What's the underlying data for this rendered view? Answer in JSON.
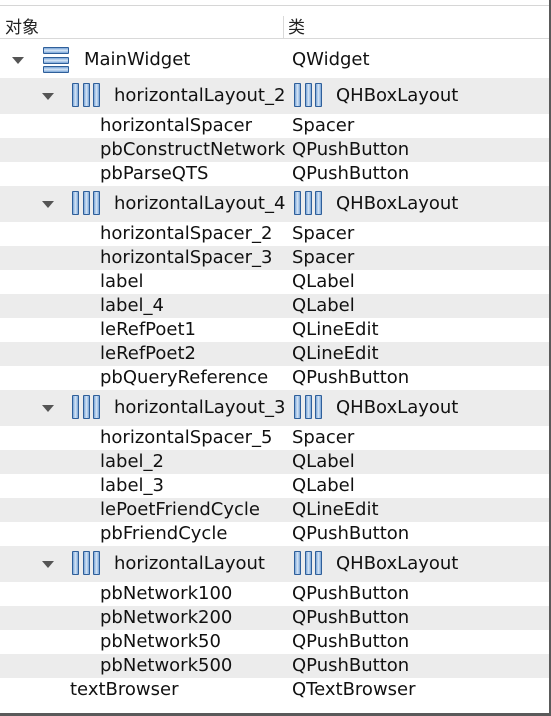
{
  "header": {
    "col_object": "对象",
    "col_class": "类"
  },
  "rows": [
    {
      "level": 0,
      "name": "MainWidget",
      "cls": "QWidget",
      "icon": "form-icon",
      "expand": true,
      "alt": false
    },
    {
      "level": 1,
      "name": "horizontalLayout_2",
      "cls": "QHBoxLayout",
      "icon": "layout-icon",
      "expand": true,
      "alt": true
    },
    {
      "level": 2,
      "name": "horizontalSpacer",
      "cls": "Spacer",
      "alt": false
    },
    {
      "level": 2,
      "name": "pbConstructNetwork",
      "cls": "QPushButton",
      "alt": true
    },
    {
      "level": 2,
      "name": "pbParseQTS",
      "cls": "QPushButton",
      "alt": false
    },
    {
      "level": 1,
      "name": "horizontalLayout_4",
      "cls": "QHBoxLayout",
      "icon": "layout-icon",
      "expand": true,
      "alt": true
    },
    {
      "level": 2,
      "name": "horizontalSpacer_2",
      "cls": "Spacer",
      "alt": false
    },
    {
      "level": 2,
      "name": "horizontalSpacer_3",
      "cls": "Spacer",
      "alt": true
    },
    {
      "level": 2,
      "name": "label",
      "cls": "QLabel",
      "alt": false
    },
    {
      "level": 2,
      "name": "label_4",
      "cls": "QLabel",
      "alt": true
    },
    {
      "level": 2,
      "name": "leRefPoet1",
      "cls": "QLineEdit",
      "alt": false
    },
    {
      "level": 2,
      "name": "leRefPoet2",
      "cls": "QLineEdit",
      "alt": true
    },
    {
      "level": 2,
      "name": "pbQueryReference",
      "cls": "QPushButton",
      "alt": false
    },
    {
      "level": 1,
      "name": "horizontalLayout_3",
      "cls": "QHBoxLayout",
      "icon": "layout-icon",
      "expand": true,
      "alt": true
    },
    {
      "level": 2,
      "name": "horizontalSpacer_5",
      "cls": "Spacer",
      "alt": false
    },
    {
      "level": 2,
      "name": "label_2",
      "cls": "QLabel",
      "alt": true
    },
    {
      "level": 2,
      "name": "label_3",
      "cls": "QLabel",
      "alt": false
    },
    {
      "level": 2,
      "name": "lePoetFriendCycle",
      "cls": "QLineEdit",
      "alt": true
    },
    {
      "level": 2,
      "name": "pbFriendCycle",
      "cls": "QPushButton",
      "alt": false
    },
    {
      "level": 1,
      "name": "horizontalLayout",
      "cls": "QHBoxLayout",
      "icon": "layout-icon",
      "expand": true,
      "alt": true
    },
    {
      "level": 2,
      "name": "pbNetwork100",
      "cls": "QPushButton",
      "alt": false
    },
    {
      "level": 2,
      "name": "pbNetwork200",
      "cls": "QPushButton",
      "alt": true
    },
    {
      "level": 2,
      "name": "pbNetwork50",
      "cls": "QPushButton",
      "alt": false
    },
    {
      "level": 2,
      "name": "pbNetwork500",
      "cls": "QPushButton",
      "alt": true
    },
    {
      "level": 1,
      "name": "textBrowser",
      "cls": "QTextBrowser",
      "alt": false
    }
  ]
}
